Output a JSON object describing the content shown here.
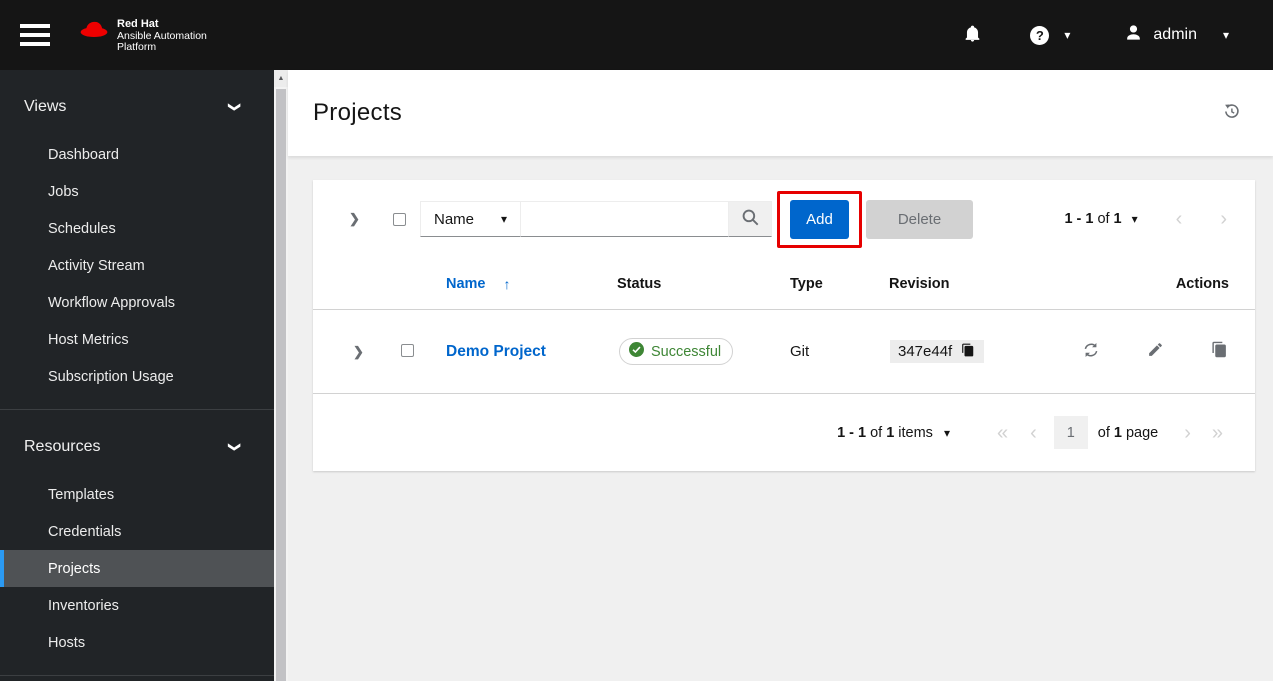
{
  "masthead": {
    "brand": {
      "line1": "Red Hat",
      "line2": "Ansible Automation",
      "line3": "Platform"
    },
    "help_glyph": "?",
    "user_label": "admin"
  },
  "sidebar": {
    "sections": [
      {
        "label": "Views",
        "items": [
          "Dashboard",
          "Jobs",
          "Schedules",
          "Activity Stream",
          "Workflow Approvals",
          "Host Metrics",
          "Subscription Usage"
        ]
      },
      {
        "label": "Resources",
        "items": [
          "Templates",
          "Credentials",
          "Projects",
          "Inventories",
          "Hosts"
        ],
        "active_item": "Projects"
      }
    ]
  },
  "page": {
    "title": "Projects"
  },
  "toolbar": {
    "filter_label": "Name",
    "search_value": "",
    "search_placeholder": "",
    "add_label": "Add",
    "delete_label": "Delete",
    "pagination": {
      "range": "1 - 1",
      "of_word": "of",
      "total": "1"
    }
  },
  "table": {
    "headers": {
      "name": "Name",
      "status": "Status",
      "type": "Type",
      "revision": "Revision",
      "actions": "Actions"
    },
    "row": {
      "name": "Demo Project",
      "status": "Successful",
      "type": "Git",
      "revision": "347e44f"
    }
  },
  "footer_pagination": {
    "range": "1 - 1",
    "of_word": "of",
    "total": "1",
    "items_word": "items",
    "page_value": "1",
    "of_word2": "of",
    "pages_total": "1",
    "page_word": "page"
  },
  "glyphs": {
    "caret_down": "▾",
    "chevron_right": "❯",
    "sort_asc": "↑",
    "angle_left": "‹",
    "angle_right": "›",
    "angle_double_left": "«",
    "angle_double_right": "»",
    "scroll_up": "▲"
  },
  "colors": {
    "accent_blue": "#0066cc",
    "success_green": "#3e8635",
    "annotation_red": "#e60000",
    "active_nav_indicator": "#2b9af3",
    "masthead_bg": "#151515",
    "sidebar_bg": "#212427",
    "content_bg": "#f0f0f0",
    "disabled_gray": "#d2d2d2",
    "icon_gray": "#6a6e73",
    "brand_red": "#ee0000"
  }
}
